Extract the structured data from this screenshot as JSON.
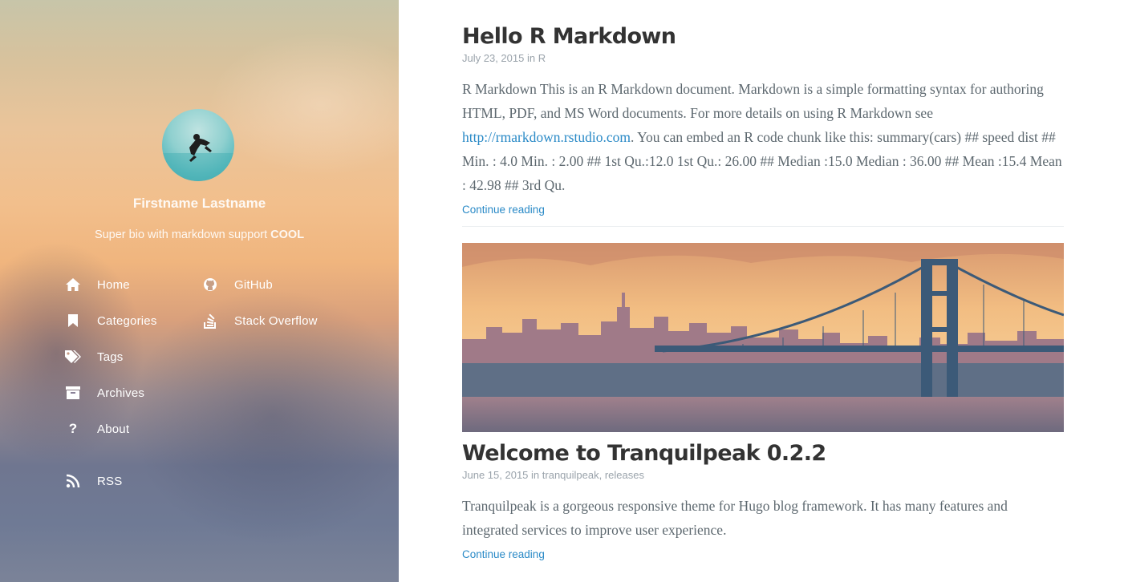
{
  "sidebar": {
    "author_name": "Firstname Lastname",
    "bio_text": "Super bio with markdown support ",
    "bio_bold": "COOL",
    "nav": [
      {
        "label": "Home",
        "icon": "home-icon"
      },
      {
        "label": "Categories",
        "icon": "bookmark-icon"
      },
      {
        "label": "Tags",
        "icon": "tags-icon"
      },
      {
        "label": "Archives",
        "icon": "archive-icon"
      },
      {
        "label": "About",
        "icon": "question-icon"
      }
    ],
    "links": [
      {
        "label": "GitHub",
        "icon": "github-icon"
      },
      {
        "label": "Stack Overflow",
        "icon": "stack-overflow-icon"
      }
    ],
    "rss": {
      "label": "RSS",
      "icon": "rss-icon"
    }
  },
  "posts": [
    {
      "title": "Hello R Markdown",
      "date": "July 23, 2015",
      "in": "in",
      "category": "R",
      "excerpt_before": "R Markdown This is an R Markdown document. Markdown is a simple formatting syntax for authoring HTML, PDF, and MS Word documents. For more details on using R Markdown see ",
      "excerpt_link": "http://rmarkdown.rstudio.com",
      "excerpt_after": ". You can embed an R code chunk like this: summary(cars) ## speed dist ## Min. : 4.0 Min. : 2.00 ## 1st Qu.:12.0 1st Qu.: 26.00 ## Median :15.0 Median : 36.00 ## Mean :15.4 Mean : 42.98 ## 3rd Qu.",
      "continue": "Continue reading"
    },
    {
      "title": "Welcome to Tranquilpeak 0.2.2",
      "date": "June 15, 2015",
      "in": "in",
      "category": "tranquilpeak",
      "category_sep": ", ",
      "category2": "releases",
      "excerpt": "Tranquilpeak is a gorgeous responsive theme for Hugo blog framework. It has many features and integrated services to improve user experience.",
      "continue": "Continue reading"
    }
  ],
  "colors": {
    "link": "#2a8ac7",
    "title": "#333333",
    "meta": "#9aa3ab",
    "body_text": "#5d686f"
  }
}
